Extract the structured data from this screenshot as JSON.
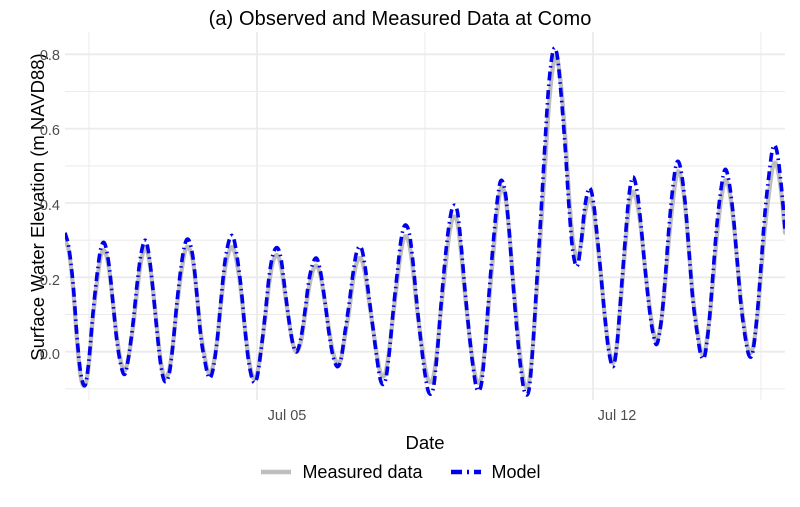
{
  "chart_data": {
    "type": "line",
    "title": "(a) Observed and Measured Data at Como",
    "xlabel": "Date",
    "ylabel": "Surface Water Elevation (m NAVD88)",
    "ylim": [
      -0.13,
      0.86
    ],
    "xlim": [
      "Jul 01",
      "Jul 16"
    ],
    "grid": true,
    "legend_position": "bottom",
    "y_ticks": [
      "0.0",
      "0.2",
      "0.4",
      "0.6",
      "0.8"
    ],
    "y_tick_values": [
      0.0,
      0.2,
      0.4,
      0.6,
      0.8
    ],
    "x_ticks": [
      "Jul 05",
      "Jul 12"
    ],
    "x_tick_values": [
      4,
      11
    ],
    "colors": {
      "measured": "#bebebe",
      "model": "#0000ee",
      "grid": "#ebebeb",
      "panel": "#ffffff",
      "text": "#000000",
      "tick_text": "#4d4d4d"
    },
    "series": [
      {
        "name": "Measured data",
        "style": "solid",
        "color": "#bebebe",
        "width": 4.2,
        "x": [
          0.0,
          0.08,
          0.17,
          0.25,
          0.33,
          0.42,
          0.5,
          0.58,
          0.67,
          0.75,
          0.83,
          0.92,
          1.0,
          1.08,
          1.17,
          1.25,
          1.33,
          1.42,
          1.5,
          1.58,
          1.67,
          1.75,
          1.83,
          1.92,
          2.0,
          2.08,
          2.17,
          2.25,
          2.33,
          2.42,
          2.5,
          2.58,
          2.67,
          2.75,
          2.83,
          2.92,
          3.0,
          3.08,
          3.17,
          3.25,
          3.33,
          3.42,
          3.5,
          3.58,
          3.67,
          3.75,
          3.83,
          3.92,
          4.0,
          4.08,
          4.17,
          4.25,
          4.33,
          4.42,
          4.5,
          4.58,
          4.67,
          4.75,
          4.83,
          4.92,
          5.0,
          5.08,
          5.17,
          5.25,
          5.33,
          5.42,
          5.5,
          5.58,
          5.67,
          5.75,
          5.83,
          5.92,
          6.0,
          6.08,
          6.17,
          6.25,
          6.33,
          6.42,
          6.5,
          6.58,
          6.67,
          6.75,
          6.83,
          6.92,
          7.0,
          7.08,
          7.17,
          7.25,
          7.33,
          7.42,
          7.5,
          7.58,
          7.67,
          7.75,
          7.83,
          7.92,
          8.0,
          8.08,
          8.17,
          8.25,
          8.33,
          8.42,
          8.5,
          8.58,
          8.67,
          8.75,
          8.83,
          8.92,
          9.0,
          9.08,
          9.17,
          9.25,
          9.33,
          9.42,
          9.5,
          9.58,
          9.67,
          9.75,
          9.83,
          9.92,
          10.0,
          10.08,
          10.17,
          10.25,
          10.33,
          10.42,
          10.5,
          10.58,
          10.67,
          10.75,
          10.83,
          10.92,
          11.0,
          11.08,
          11.17,
          11.25,
          11.33,
          11.42,
          11.5,
          11.58,
          11.67,
          11.75,
          11.83,
          11.92,
          12.0,
          12.08,
          12.17,
          12.25,
          12.33,
          12.42,
          12.5,
          12.58,
          12.67,
          12.75,
          12.83,
          12.92,
          13.0,
          13.08,
          13.17,
          13.25,
          13.33,
          13.42,
          13.5,
          13.58,
          13.67,
          13.75,
          13.83,
          13.92,
          14.0,
          14.08,
          14.17,
          14.25,
          14.33,
          14.42,
          14.5,
          14.58,
          14.67,
          14.75,
          14.83,
          14.92,
          15.0
        ],
        "y": [
          0.3,
          0.27,
          0.17,
          0.03,
          -0.07,
          -0.09,
          -0.03,
          0.09,
          0.19,
          0.26,
          0.27,
          0.22,
          0.13,
          0.04,
          -0.03,
          -0.05,
          -0.01,
          0.07,
          0.16,
          0.24,
          0.28,
          0.25,
          0.17,
          0.06,
          -0.03,
          -0.07,
          -0.05,
          0.02,
          0.12,
          0.21,
          0.27,
          0.28,
          0.24,
          0.15,
          0.05,
          -0.02,
          -0.06,
          -0.04,
          0.03,
          0.13,
          0.22,
          0.27,
          0.28,
          0.24,
          0.16,
          0.06,
          -0.02,
          -0.07,
          -0.06,
          0.0,
          0.09,
          0.18,
          0.24,
          0.26,
          0.23,
          0.16,
          0.08,
          0.02,
          0.0,
          0.03,
          0.1,
          0.17,
          0.22,
          0.23,
          0.2,
          0.13,
          0.06,
          0.0,
          -0.03,
          -0.02,
          0.04,
          0.11,
          0.19,
          0.24,
          0.25,
          0.21,
          0.14,
          0.06,
          -0.01,
          -0.06,
          -0.06,
          0.0,
          0.09,
          0.19,
          0.27,
          0.31,
          0.29,
          0.22,
          0.12,
          0.03,
          -0.04,
          -0.08,
          -0.07,
          0.0,
          0.11,
          0.22,
          0.31,
          0.36,
          0.35,
          0.27,
          0.16,
          0.05,
          -0.03,
          -0.08,
          -0.07,
          0.01,
          0.13,
          0.26,
          0.37,
          0.44,
          0.42,
          0.33,
          0.2,
          0.07,
          -0.03,
          -0.09,
          -0.08,
          0.02,
          0.17,
          0.34,
          0.5,
          0.66,
          0.77,
          0.79,
          0.72,
          0.58,
          0.42,
          0.3,
          0.25,
          0.29,
          0.37,
          0.41,
          0.39,
          0.31,
          0.2,
          0.09,
          0.01,
          -0.03,
          0.02,
          0.14,
          0.28,
          0.39,
          0.43,
          0.4,
          0.33,
          0.23,
          0.13,
          0.06,
          0.03,
          0.08,
          0.18,
          0.3,
          0.41,
          0.48,
          0.47,
          0.39,
          0.27,
          0.15,
          0.06,
          0.0,
          0.0,
          0.08,
          0.19,
          0.31,
          0.41,
          0.46,
          0.44,
          0.36,
          0.25,
          0.14,
          0.05,
          0.0,
          0.01,
          0.09,
          0.21,
          0.33,
          0.43,
          0.5,
          0.5,
          0.43,
          0.32
        ]
      },
      {
        "name": "Model",
        "style": "dash-dot",
        "color": "#0000ee",
        "width": 3.6,
        "x": [
          0.0,
          0.08,
          0.17,
          0.25,
          0.33,
          0.42,
          0.5,
          0.58,
          0.67,
          0.75,
          0.83,
          0.92,
          1.0,
          1.08,
          1.17,
          1.25,
          1.33,
          1.42,
          1.5,
          1.58,
          1.67,
          1.75,
          1.83,
          1.92,
          2.0,
          2.08,
          2.17,
          2.25,
          2.33,
          2.42,
          2.5,
          2.58,
          2.67,
          2.75,
          2.83,
          2.92,
          3.0,
          3.08,
          3.17,
          3.25,
          3.33,
          3.42,
          3.5,
          3.58,
          3.67,
          3.75,
          3.83,
          3.92,
          4.0,
          4.08,
          4.17,
          4.25,
          4.33,
          4.42,
          4.5,
          4.58,
          4.67,
          4.75,
          4.83,
          4.92,
          5.0,
          5.08,
          5.17,
          5.25,
          5.33,
          5.42,
          5.5,
          5.58,
          5.67,
          5.75,
          5.83,
          5.92,
          6.0,
          6.08,
          6.17,
          6.25,
          6.33,
          6.42,
          6.5,
          6.58,
          6.67,
          6.75,
          6.83,
          6.92,
          7.0,
          7.08,
          7.17,
          7.25,
          7.33,
          7.42,
          7.5,
          7.58,
          7.67,
          7.75,
          7.83,
          7.92,
          8.0,
          8.08,
          8.17,
          8.25,
          8.33,
          8.42,
          8.5,
          8.58,
          8.67,
          8.75,
          8.83,
          8.92,
          9.0,
          9.08,
          9.17,
          9.25,
          9.33,
          9.42,
          9.5,
          9.58,
          9.67,
          9.75,
          9.83,
          9.92,
          10.0,
          10.08,
          10.17,
          10.25,
          10.33,
          10.42,
          10.5,
          10.58,
          10.67,
          10.75,
          10.83,
          10.92,
          11.0,
          11.08,
          11.17,
          11.25,
          11.33,
          11.42,
          11.5,
          11.58,
          11.67,
          11.75,
          11.83,
          11.92,
          12.0,
          12.08,
          12.17,
          12.25,
          12.33,
          12.42,
          12.5,
          12.58,
          12.67,
          12.75,
          12.83,
          12.92,
          13.0,
          13.08,
          13.17,
          13.25,
          13.33,
          13.42,
          13.5,
          13.58,
          13.67,
          13.75,
          13.83,
          13.92,
          14.0,
          14.08,
          14.17,
          14.25,
          14.33,
          14.42,
          14.5,
          14.58,
          14.67,
          14.75,
          14.83,
          14.92,
          15.0
        ],
        "y": [
          0.32,
          0.28,
          0.18,
          0.04,
          -0.06,
          -0.09,
          -0.02,
          0.1,
          0.21,
          0.28,
          0.29,
          0.23,
          0.13,
          0.03,
          -0.04,
          -0.06,
          -0.01,
          0.08,
          0.18,
          0.26,
          0.3,
          0.26,
          0.17,
          0.05,
          -0.04,
          -0.08,
          -0.06,
          0.02,
          0.13,
          0.23,
          0.29,
          0.3,
          0.25,
          0.15,
          0.04,
          -0.03,
          -0.07,
          -0.05,
          0.03,
          0.14,
          0.24,
          0.3,
          0.31,
          0.26,
          0.17,
          0.06,
          -0.03,
          -0.08,
          -0.07,
          0.0,
          0.1,
          0.2,
          0.26,
          0.28,
          0.25,
          0.17,
          0.08,
          0.02,
          0.0,
          0.04,
          0.11,
          0.19,
          0.24,
          0.25,
          0.21,
          0.13,
          0.05,
          -0.01,
          -0.04,
          -0.02,
          0.05,
          0.13,
          0.21,
          0.27,
          0.28,
          0.23,
          0.15,
          0.06,
          -0.02,
          -0.08,
          -0.08,
          -0.01,
          0.1,
          0.21,
          0.3,
          0.34,
          0.32,
          0.24,
          0.13,
          0.02,
          -0.06,
          -0.11,
          -0.1,
          -0.01,
          0.12,
          0.25,
          0.34,
          0.39,
          0.38,
          0.29,
          0.17,
          0.05,
          -0.04,
          -0.1,
          -0.09,
          0.01,
          0.15,
          0.29,
          0.4,
          0.46,
          0.43,
          0.33,
          0.19,
          0.05,
          -0.05,
          -0.11,
          -0.1,
          0.02,
          0.19,
          0.38,
          0.56,
          0.72,
          0.81,
          0.8,
          0.7,
          0.55,
          0.39,
          0.27,
          0.23,
          0.29,
          0.39,
          0.44,
          0.41,
          0.32,
          0.2,
          0.09,
          0.0,
          -0.04,
          0.02,
          0.15,
          0.3,
          0.42,
          0.47,
          0.43,
          0.34,
          0.23,
          0.12,
          0.05,
          0.02,
          0.08,
          0.19,
          0.33,
          0.45,
          0.51,
          0.49,
          0.4,
          0.27,
          0.14,
          0.05,
          -0.01,
          -0.01,
          0.08,
          0.21,
          0.34,
          0.44,
          0.49,
          0.46,
          0.37,
          0.25,
          0.13,
          0.04,
          -0.01,
          0.0,
          0.1,
          0.23,
          0.37,
          0.48,
          0.55,
          0.54,
          0.45,
          0.33
        ]
      }
    ]
  },
  "legend": {
    "items": [
      {
        "label": "Measured data",
        "key": "line-solid-gray"
      },
      {
        "label": "Model",
        "key": "line-dashdot-blue"
      }
    ]
  }
}
